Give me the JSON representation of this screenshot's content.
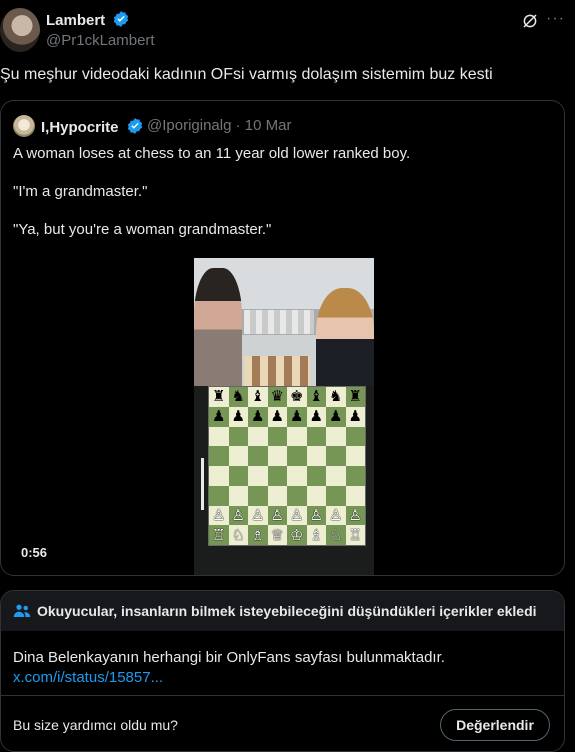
{
  "post": {
    "author_name": "Lambert",
    "author_handle": "@Pr1ckLambert",
    "text": "Şu meşhur videodaki kadının OFsi varmış dolaşım sistemim buz kesti",
    "more_label": "···"
  },
  "quoted": {
    "author_name": "I,Hypocrite",
    "meta": "@Iporiginalg · 10 Mar",
    "lines": [
      "A woman loses at chess to an 11 year old lower ranked boy.",
      "\"I'm a grandmaster.\"",
      "\"Ya, but you're a woman grandmaster.\""
    ],
    "video_duration": "0:56"
  },
  "chess_board": [
    [
      "♜",
      "♞",
      "♝",
      "♛",
      "♚",
      "♝",
      "♞",
      "♜"
    ],
    [
      "♟",
      "♟",
      "♟",
      "♟",
      "♟",
      "♟",
      "♟",
      "♟"
    ],
    [
      "",
      "",
      "",
      "",
      "",
      "",
      "",
      ""
    ],
    [
      "",
      "",
      "",
      "",
      "",
      "",
      "",
      ""
    ],
    [
      "",
      "",
      "",
      "",
      "",
      "",
      "",
      ""
    ],
    [
      "",
      "",
      "",
      "",
      "",
      "",
      "",
      ""
    ],
    [
      "♙",
      "♙",
      "♙",
      "♙",
      "♙",
      "♙",
      "♙",
      "♙"
    ],
    [
      "♖",
      "♘",
      "♗",
      "♕",
      "♔",
      "♗",
      "♘",
      "♖"
    ]
  ],
  "community_note": {
    "title": "Okuyucular, insanların bilmek isteyebileceğini düşündükleri içerikler ekledi",
    "body": "Dina Belenkayanın herhangi bir OnlyFans sayfası bulunmaktadır.",
    "link": "x.com/i/status/15857...",
    "question": "Bu size yardımcı oldu mu?",
    "rate_label": "Değerlendir"
  },
  "colors": {
    "verified": "#1d9bf0",
    "link": "#1d9bf0",
    "board_light": "#eeeed2",
    "board_dark": "#769656"
  }
}
